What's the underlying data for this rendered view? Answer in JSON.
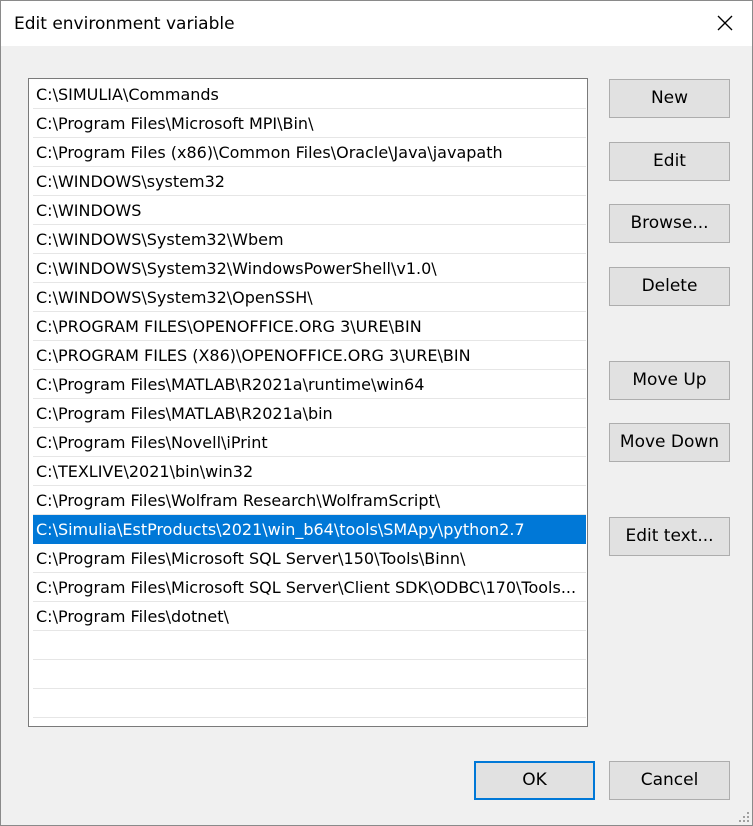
{
  "dialog": {
    "title": "Edit environment variable"
  },
  "paths": [
    "C:\\SIMULIA\\Commands",
    "C:\\Program Files\\Microsoft MPI\\Bin\\",
    "C:\\Program Files (x86)\\Common Files\\Oracle\\Java\\javapath",
    "C:\\WINDOWS\\system32",
    "C:\\WINDOWS",
    "C:\\WINDOWS\\System32\\Wbem",
    "C:\\WINDOWS\\System32\\WindowsPowerShell\\v1.0\\",
    "C:\\WINDOWS\\System32\\OpenSSH\\",
    "C:\\PROGRAM FILES\\OPENOFFICE.ORG 3\\URE\\BIN",
    "C:\\PROGRAM FILES (X86)\\OPENOFFICE.ORG 3\\URE\\BIN",
    "C:\\Program Files\\MATLAB\\R2021a\\runtime\\win64",
    "C:\\Program Files\\MATLAB\\R2021a\\bin",
    "C:\\Program Files\\Novell\\iPrint",
    "C:\\TEXLIVE\\2021\\bin\\win32",
    "C:\\Program Files\\Wolfram Research\\WolframScript\\",
    "C:\\Simulia\\EstProducts\\2021\\win_b64\\tools\\SMApy\\python2.7",
    "C:\\Program Files\\Microsoft SQL Server\\150\\Tools\\Binn\\",
    "C:\\Program Files\\Microsoft SQL Server\\Client SDK\\ODBC\\170\\Tools...",
    "C:\\Program Files\\dotnet\\",
    "",
    "",
    ""
  ],
  "selected_index": 15,
  "buttons": {
    "new": "New",
    "edit": "Edit",
    "browse": "Browse...",
    "delete": "Delete",
    "move_up": "Move Up",
    "move_down": "Move Down",
    "edit_text": "Edit text...",
    "ok": "OK",
    "cancel": "Cancel"
  },
  "colors": {
    "selection": "#0078d7",
    "default_button_border": "#0078d7"
  }
}
